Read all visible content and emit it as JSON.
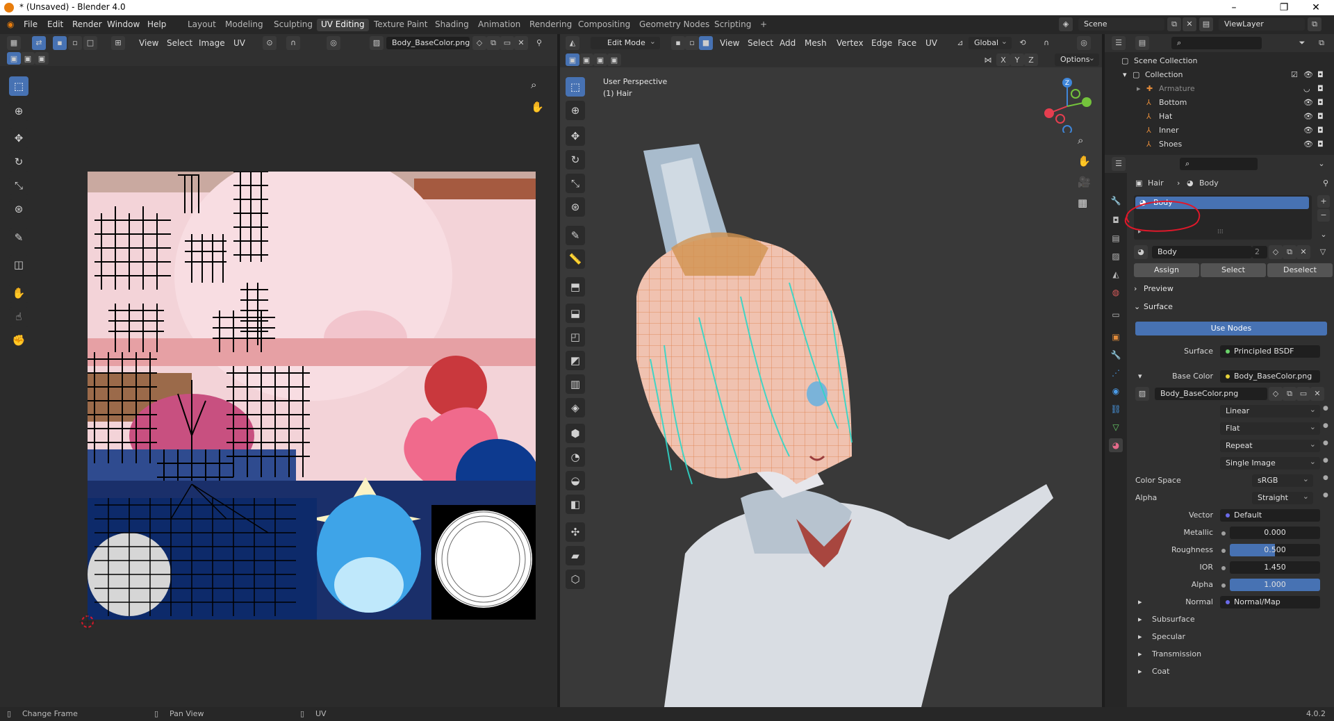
{
  "window": {
    "title": "* (Unsaved) - Blender 4.0",
    "min": "–",
    "max": "❐",
    "close": "✕"
  },
  "menu": [
    "File",
    "Edit",
    "Render",
    "Window",
    "Help"
  ],
  "workspaces": [
    "Layout",
    "Modeling",
    "Sculpting",
    "UV Editing",
    "Texture Paint",
    "Shading",
    "Animation",
    "Rendering",
    "Compositing",
    "Geometry Nodes",
    "Scripting"
  ],
  "active_workspace": "UV Editing",
  "add_workspace": "+",
  "scene": {
    "name": "Scene",
    "view_layer": "ViewLayer"
  },
  "uv_editor": {
    "menus": [
      "View",
      "Select",
      "Image",
      "UV"
    ],
    "image_name": "Body_BaseColor.png"
  },
  "viewport": {
    "mode": "Edit Mode",
    "menus": [
      "View",
      "Select",
      "Add",
      "Mesh",
      "Vertex",
      "Edge",
      "Face",
      "UV"
    ],
    "transform": "Global",
    "options": "Options",
    "axes": [
      "X",
      "Y",
      "Z"
    ],
    "overlay_title": "User Perspective",
    "overlay_sub": "(1) Hair",
    "gizmo": {
      "z": "Z",
      "x_color": "#e53e4f",
      "y_color": "#74c33c",
      "z_color": "#3f86d9"
    }
  },
  "outliner": {
    "root": "Scene Collection",
    "collection": "Collection",
    "items": [
      "Armature",
      "Bottom",
      "Hat",
      "Inner",
      "Shoes"
    ]
  },
  "properties": {
    "breadcrumb": [
      "Hair",
      "Body"
    ],
    "slot": "Body",
    "material_name": "Body",
    "users": "2",
    "buttons": [
      "Assign",
      "Select",
      "Deselect"
    ],
    "preview": "Preview",
    "surface_section": "Surface",
    "use_nodes": "Use Nodes",
    "surface_label": "Surface",
    "surface_value": "Principled BSDF",
    "base_color_label": "Base Color",
    "base_color_value": "Body_BaseColor.png",
    "image_field": "Body_BaseColor.png",
    "interp": "Linear",
    "projection": "Flat",
    "extension": "Repeat",
    "source": "Single Image",
    "color_space_label": "Color Space",
    "color_space": "sRGB",
    "alpha_label": "Alpha",
    "alpha_mode": "Straight",
    "vector_label": "Vector",
    "vector_value": "Default",
    "metallic_label": "Metallic",
    "metallic": "0.000",
    "roughness_label": "Roughness",
    "roughness": "0.500",
    "ior_label": "IOR",
    "ior": "1.450",
    "alpha2_label": "Alpha",
    "alpha_value": "1.000",
    "normal_label": "Normal",
    "normal_value": "Normal/Map",
    "subsections": [
      "Subsurface",
      "Specular",
      "Transmission",
      "Coat"
    ]
  },
  "status": {
    "left": "Change Frame",
    "mid": "Pan View",
    "right": "UV",
    "version": "4.0.2"
  },
  "colors": {
    "accent": "#4772b3",
    "annotation": "#e0182a",
    "mesh_edge": "#e8913a",
    "seam": "#2fd7c8"
  }
}
